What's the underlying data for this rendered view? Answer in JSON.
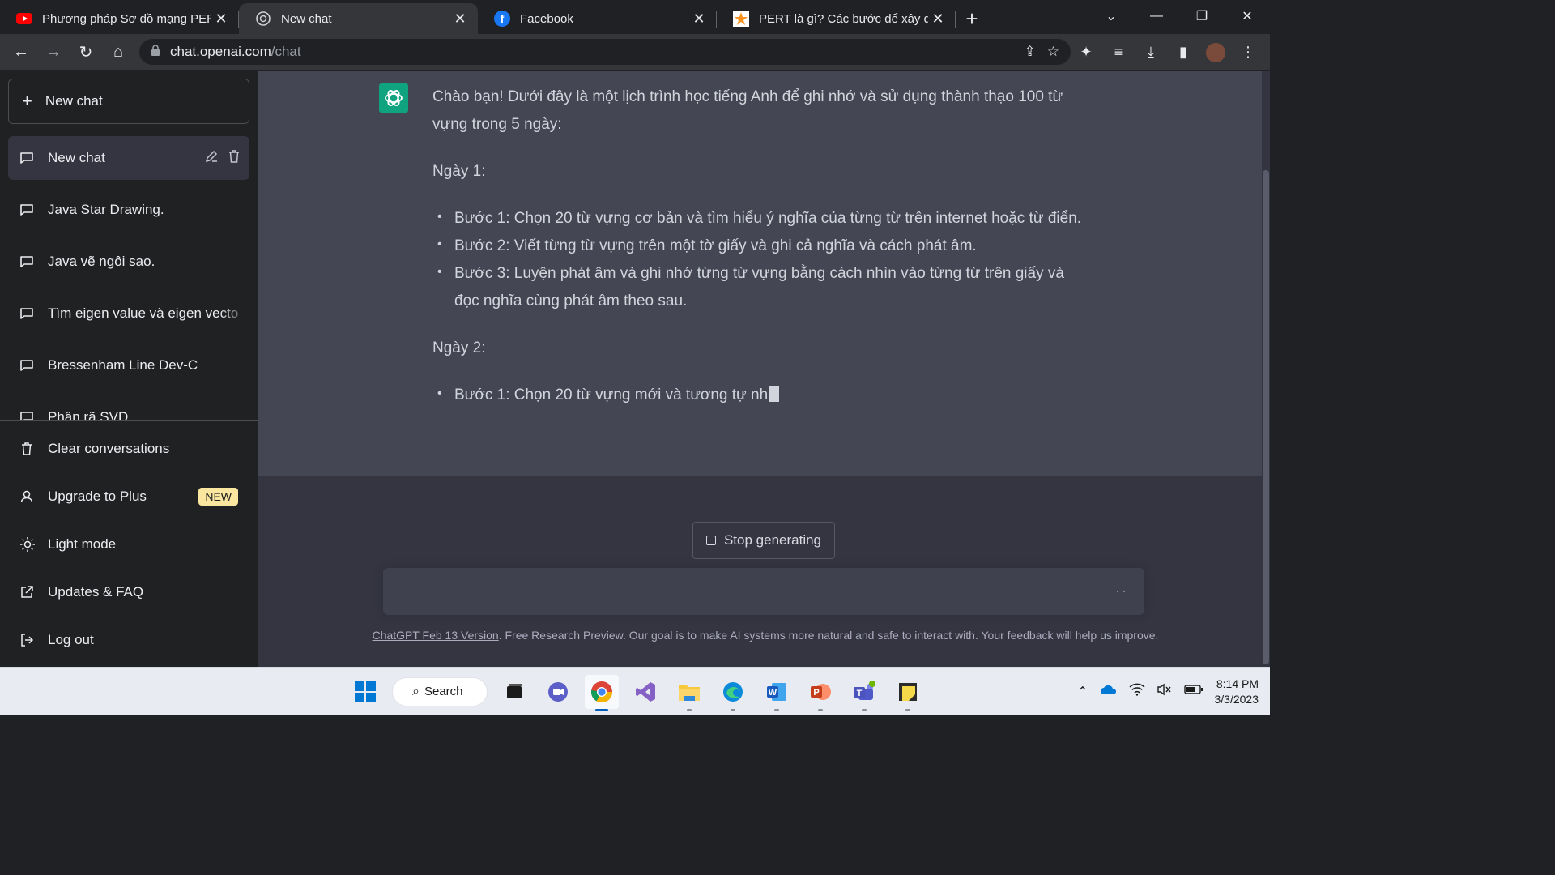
{
  "browser": {
    "tabs": [
      {
        "title": "Phương pháp Sơ đồ mạng PERT...",
        "favicon": "youtube-icon",
        "active": false
      },
      {
        "title": "New chat",
        "favicon": "chatgpt-icon",
        "active": true
      },
      {
        "title": "Facebook",
        "favicon": "facebook-icon",
        "active": false
      },
      {
        "title": "PERT là gì? Các bước để xây dựng...",
        "favicon": "star-site-icon",
        "active": false
      }
    ],
    "address": {
      "host": "chat.openai.com",
      "path": "/chat"
    }
  },
  "sidebar": {
    "new_chat_label": "New chat",
    "chats": [
      {
        "label": "New chat",
        "active": true
      },
      {
        "label": "Java Star Drawing."
      },
      {
        "label": "Java vẽ ngôi sao."
      },
      {
        "label": "Tìm eigen value và eigen vecto"
      },
      {
        "label": "Bressenham Line Dev-C"
      },
      {
        "label": "Phân rã SVD"
      }
    ],
    "bottom": {
      "clear": "Clear conversations",
      "upgrade": "Upgrade to Plus",
      "upgrade_badge": "NEW",
      "light_mode": "Light mode",
      "updates": "Updates & FAQ",
      "logout": "Log out"
    }
  },
  "conversation": {
    "intro": "Chào bạn! Dưới đây là một lịch trình học tiếng Anh để ghi nhớ và sử dụng thành thạo 100 từ vựng trong 5 ngày:",
    "day1_heading": "Ngày 1:",
    "day1_steps": [
      "Bước 1: Chọn 20 từ vựng cơ bản và tìm hiểu ý nghĩa của từng từ trên internet hoặc từ điển.",
      "Bước 2: Viết từng từ vựng trên một tờ giấy và ghi cả nghĩa và cách phát âm.",
      "Bước 3: Luyện phát âm và ghi nhớ từng từ vựng bằng cách nhìn vào từng từ trên giấy và đọc nghĩa cùng phát âm theo sau."
    ],
    "day2_heading": "Ngày 2:",
    "day2_steps": [
      "Bước 1: Chọn 20 từ vựng mới và tương tự nh"
    ]
  },
  "controls": {
    "stop_label": "Stop generating",
    "footer_link": "ChatGPT Feb 13 Version",
    "footer_text": ". Free Research Preview. Our goal is to make AI systems more natural and safe to interact with. Your feedback will help us improve."
  },
  "taskbar": {
    "search_label": "Search",
    "time": "8:14 PM",
    "date": "3/3/2023"
  },
  "colors": {
    "accent": "#10a37f",
    "sidebar_bg": "#202123",
    "main_bg": "#343541",
    "message_bg": "#444654"
  }
}
